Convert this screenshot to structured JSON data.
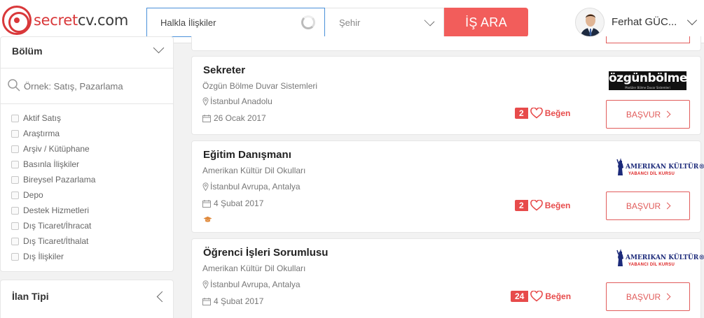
{
  "brand": {
    "part1": "secret",
    "part2": "cv.com"
  },
  "search": {
    "query": "Halkla İlişkiler",
    "city_placeholder": "Şehir",
    "button_label": "İŞ ARA"
  },
  "user": {
    "name": "Ferhat GÜC..."
  },
  "sidebar": {
    "bolum": {
      "title": "Bölüm",
      "search_placeholder": "Örnek: Satış, Pazarlama",
      "items": [
        "Aktif Satış",
        "Araştırma",
        "Arşiv / Kütüphane",
        "Basınla İlişkiler",
        "Bireysel Pazarlama",
        "Depo",
        "Destek Hizmetleri",
        "Dış Ticaret/İhracat",
        "Dış Ticaret/İthalat",
        "Dış İlişkiler"
      ]
    },
    "ilan_tipi": {
      "title": "İlan Tipi"
    }
  },
  "jobs": [
    {
      "title": "Sekreter",
      "company": "Özgün Bölme Duvar Sistemleri",
      "location": "İstanbul Anadolu",
      "date": "26 Ocak 2017",
      "likes": "2",
      "like_label": "Beğen",
      "apply_label": "BAŞVUR",
      "company_logo": {
        "main": "özgünbölme",
        "sub": "Modüler Bölme Duvar Sistemleri"
      }
    },
    {
      "title": "Eğitim Danışmanı",
      "company": "Amerikan Kültür Dil Okulları",
      "location": "İstanbul Avrupa, Antalya",
      "date": "4 Şubat 2017",
      "likes": "2",
      "like_label": "Beğen",
      "apply_label": "BAŞVUR",
      "company_logo": {
        "main": "AMERIKAN KÜLTÜR®",
        "sub": "YABANCI DİL KURSU"
      }
    },
    {
      "title": "Öğrenci İşleri Sorumlusu",
      "company": "Amerikan Kültür Dil Okulları",
      "location": "İstanbul Avrupa, Antalya",
      "date": "4 Şubat 2017",
      "likes": "24",
      "like_label": "Beğen",
      "apply_label": "BAŞVUR",
      "company_logo": {
        "main": "AMERIKAN KÜLTÜR®",
        "sub": "YABANCI DİL KURSU"
      }
    }
  ],
  "colors": {
    "brand_red": "#d9383a",
    "search_button": "#f25d5b",
    "like_red": "#e74b4b",
    "focus_blue": "#4a90d9"
  },
  "icons": [
    "spinner-icon",
    "chevron-down-icon",
    "search-icon",
    "pin-icon",
    "calendar-icon",
    "graduation-cap-icon",
    "heart-icon",
    "chevron-right-icon",
    "chevron-left-icon"
  ]
}
